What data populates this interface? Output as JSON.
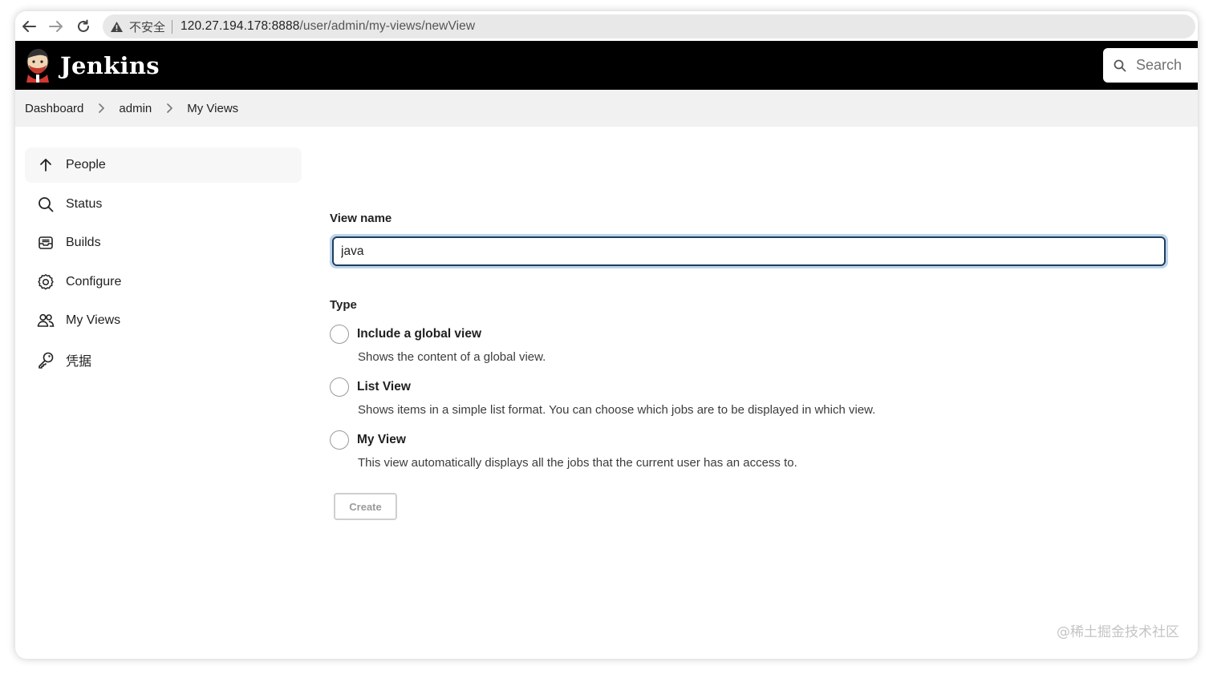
{
  "browser": {
    "insecure_label": "不安全",
    "url_host": "120.27.194.178:8888",
    "url_path": "/user/admin/my-views/newView"
  },
  "header": {
    "brand": "Jenkins",
    "search_placeholder": "Search"
  },
  "breadcrumb": {
    "items": [
      {
        "label": "Dashboard"
      },
      {
        "label": "admin"
      },
      {
        "label": "My Views"
      }
    ]
  },
  "sidebar": {
    "items": [
      {
        "label": "People",
        "icon": "arrow-up-icon",
        "active": true
      },
      {
        "label": "Status",
        "icon": "search-icon"
      },
      {
        "label": "Builds",
        "icon": "inbox-icon"
      },
      {
        "label": "Configure",
        "icon": "gear-icon"
      },
      {
        "label": "My Views",
        "icon": "people-icon"
      },
      {
        "label": "凭据",
        "icon": "key-icon"
      }
    ]
  },
  "form": {
    "view_name_label": "View name",
    "view_name_value": "java",
    "type_label": "Type",
    "options": [
      {
        "title": "Include a global view",
        "description": "Shows the content of a global view."
      },
      {
        "title": "List View",
        "description": "Shows items in a simple list format. You can choose which jobs are to be displayed in which view."
      },
      {
        "title": "My View",
        "description": "This view automatically displays all the jobs that the current user has an access to."
      }
    ],
    "create_label": "Create"
  },
  "watermark": "@稀土掘金技术社区",
  "colors": {
    "header_bg": "#000000",
    "breadcrumb_bg": "#f1f1f1",
    "input_border": "#1f3d5c",
    "input_focus_ring": "#bcd4ec"
  }
}
